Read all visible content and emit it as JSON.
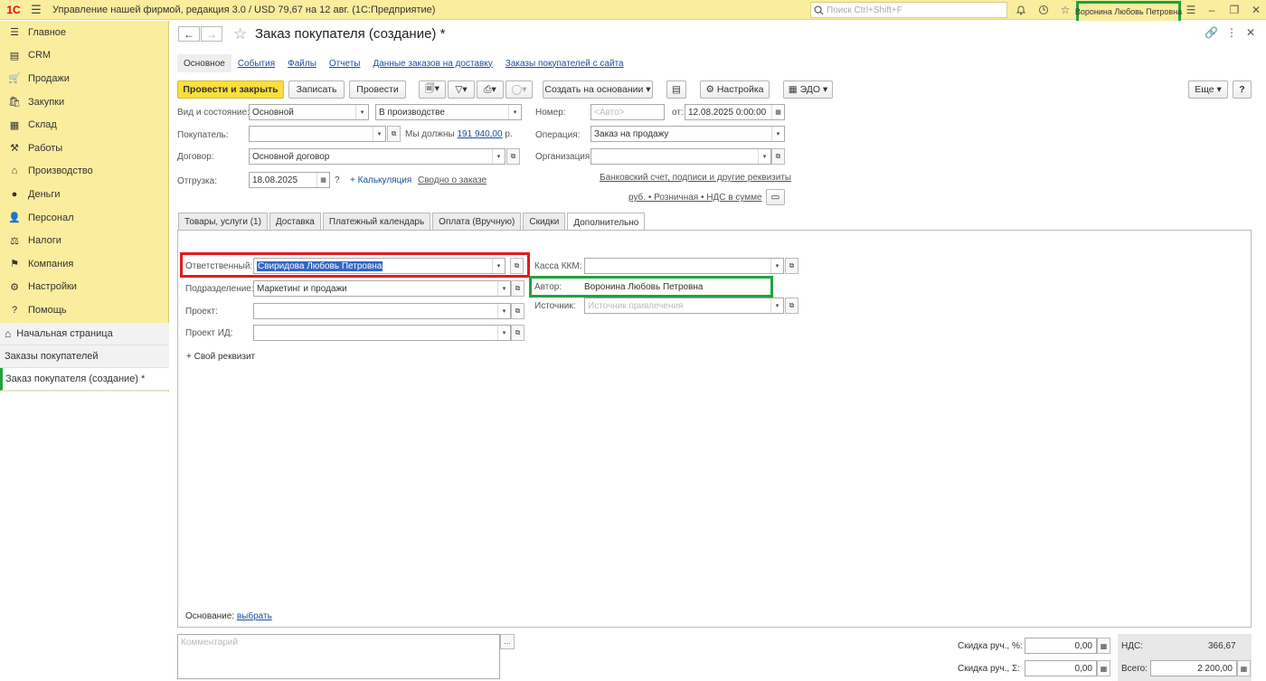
{
  "topbar": {
    "logo": "1С",
    "app_title": "Управление нашей фирмой, редакция 3.0 / USD 79,67 на 12 авг.  (1С:Предприятие)",
    "search_placeholder": "Поиск Ctrl+Shift+F",
    "user_name": "Воронина Любовь Петровна"
  },
  "sidebar": {
    "items": [
      {
        "label": "Главное",
        "icon": "menu-lines-icon"
      },
      {
        "label": "CRM",
        "icon": "crm-icon"
      },
      {
        "label": "Продажи",
        "icon": "sales-icon"
      },
      {
        "label": "Закупки",
        "icon": "purchases-icon"
      },
      {
        "label": "Склад",
        "icon": "warehouse-icon"
      },
      {
        "label": "Работы",
        "icon": "works-icon"
      },
      {
        "label": "Производство",
        "icon": "production-icon"
      },
      {
        "label": "Деньги",
        "icon": "money-icon"
      },
      {
        "label": "Персонал",
        "icon": "staff-icon"
      },
      {
        "label": "Налоги",
        "icon": "taxes-icon"
      },
      {
        "label": "Компания",
        "icon": "company-icon"
      },
      {
        "label": "Настройки",
        "icon": "settings-icon"
      },
      {
        "label": "Помощь",
        "icon": "help-icon"
      }
    ],
    "open_windows": [
      {
        "label": "Начальная страница",
        "icon": "home-icon"
      },
      {
        "label": "Заказы покупателей"
      },
      {
        "label": "Заказ покупателя (создание) *"
      }
    ]
  },
  "form": {
    "title": "Заказ покупателя (создание) *",
    "tabs": [
      "Основное",
      "События",
      "Файлы",
      "Отчеты",
      "Данные заказов на доставку",
      "Заказы покупателей с сайта"
    ],
    "toolbar": {
      "post_close": "Провести и закрыть",
      "save": "Записать",
      "post": "Провести",
      "create_based": "Создать на основании",
      "settings": "Настройка",
      "edo": "ЭДО",
      "more": "Еще",
      "help": "?"
    },
    "header": {
      "kind_state_label": "Вид и состояние:",
      "kind_value": "Основной",
      "state_value": "В производстве",
      "number_label": "Номер:",
      "number_placeholder": "<Авто>",
      "date_from_label": "от:",
      "date_value": "12.08.2025  0:00:00",
      "buyer_label": "Покупатель:",
      "buyer_value": "",
      "we_owe_text": "Мы должны",
      "we_owe_amount": "191 940,00",
      "currency_suffix": "р.",
      "operation_label": "Операция:",
      "operation_value": "Заказ на продажу",
      "contract_label": "Договор:",
      "contract_value": "Основной договор",
      "organization_label": "Организация:",
      "organization_value": "",
      "shipment_label": "Отгрузка:",
      "shipment_value": "18.08.2025",
      "question": "?",
      "calculation_link": "+ Калькуляция",
      "summary_link": "Сводно о заказе",
      "bank_link": "Банковский счет, подписи и другие реквизиты",
      "price_link": "руб. • Розничная • НДС в сумме"
    },
    "inner_tabs": [
      "Товары, услуги (1)",
      "Доставка",
      "Платежный календарь",
      "Оплата (Вручную)",
      "Скидки",
      "Дополнительно"
    ],
    "additional": {
      "responsible_label": "Ответственный:",
      "responsible_value": "Свиридова Любовь Петровна",
      "department_label": "Подразделение:",
      "department_value": "Маркетинг и продажи",
      "project_label": "Проект:",
      "project_value": "",
      "project_id_label": "Проект ИД:",
      "project_id_value": "",
      "own_attr_link": "+ Свой реквизит",
      "cash_kkm_label": "Касса ККМ:",
      "cash_kkm_value": "",
      "author_label": "Автор:",
      "author_value": "Воронина Любовь Петровна",
      "source_label": "Источник:",
      "source_placeholder": "Источник привлечения",
      "basis_label": "Основание:",
      "basis_link": "выбрать"
    },
    "footer": {
      "comment_placeholder": "Комментарий",
      "discount_pct_label": "Скидка руч., %:",
      "discount_pct_value": "0,00",
      "discount_sum_label": "Скидка руч., Σ:",
      "discount_sum_value": "0,00",
      "vat_label": "НДС:",
      "vat_value": "366,67",
      "total_label": "Всего:",
      "total_value": "2 200,00"
    }
  },
  "colors": {
    "sidebar_bg": "#fbed9e",
    "primary_button": "#fcdf3b",
    "highlight_red": "#e21b1b",
    "highlight_green": "#1fa33c",
    "link": "#1a4f9c"
  }
}
